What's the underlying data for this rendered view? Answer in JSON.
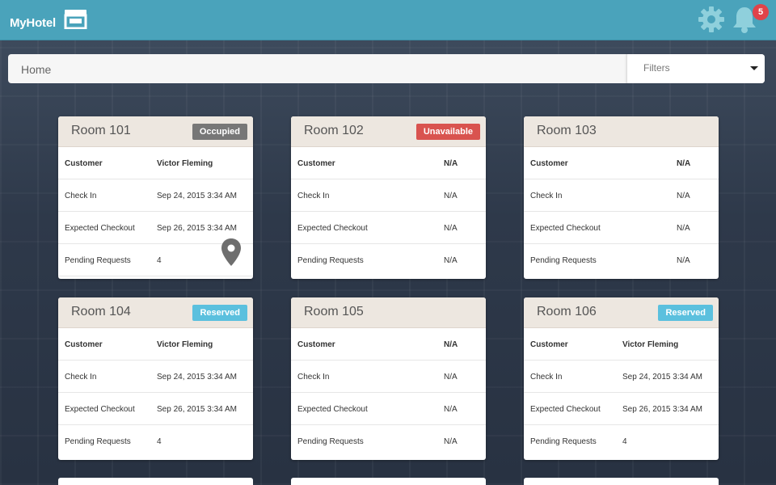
{
  "app": {
    "title": "MyHotel"
  },
  "header": {
    "notification_count": "5"
  },
  "nav": {
    "breadcrumb": "Home",
    "filters_label": "Filters"
  },
  "colors": {
    "topbar": "#4aa3bb",
    "occupied": "#777777",
    "unavailable": "#d9534f",
    "reserved": "#5bc0de"
  },
  "rooms": [
    {
      "name": "Room 101",
      "status": "Occupied",
      "status_color": "#777777",
      "rows": [
        {
          "label": "Customer",
          "value": "Victor Fleming"
        },
        {
          "label": "Check In",
          "value": "Sep 24, 2015 3:34 AM"
        },
        {
          "label": "Expected Checkout",
          "value": "Sep 26, 2015 3:34 AM"
        },
        {
          "label": "Pending Requests",
          "value": "4"
        }
      ]
    },
    {
      "name": "Room 102",
      "status": "Unavailable",
      "status_color": "#d9534f",
      "rows": [
        {
          "label": "Customer",
          "value": "N/A"
        },
        {
          "label": "Check In",
          "value": "N/A"
        },
        {
          "label": "Expected Checkout",
          "value": "N/A"
        },
        {
          "label": "Pending Requests",
          "value": "N/A"
        }
      ]
    },
    {
      "name": "Room 103",
      "status": "",
      "rows": [
        {
          "label": "Customer",
          "value": "N/A"
        },
        {
          "label": "Check In",
          "value": "N/A"
        },
        {
          "label": "Expected Checkout",
          "value": "N/A"
        },
        {
          "label": "Pending Requests",
          "value": "N/A"
        }
      ]
    },
    {
      "name": "Room 104",
      "status": "Reserved",
      "status_color": "#5bc0de",
      "rows": [
        {
          "label": "Customer",
          "value": "Victor Fleming"
        },
        {
          "label": "Check In",
          "value": "Sep 24, 2015 3:34 AM"
        },
        {
          "label": "Expected Checkout",
          "value": "Sep 26, 2015 3:34 AM"
        },
        {
          "label": "Pending Requests",
          "value": "4"
        }
      ]
    },
    {
      "name": "Room 105",
      "status": "",
      "rows": [
        {
          "label": "Customer",
          "value": "N/A"
        },
        {
          "label": "Check In",
          "value": "N/A"
        },
        {
          "label": "Expected Checkout",
          "value": "N/A"
        },
        {
          "label": "Pending Requests",
          "value": "N/A"
        }
      ]
    },
    {
      "name": "Room 106",
      "status": "Reserved",
      "status_color": "#5bc0de",
      "rows": [
        {
          "label": "Customer",
          "value": "Victor Fleming"
        },
        {
          "label": "Check In",
          "value": "Sep 24, 2015 3:34 AM"
        },
        {
          "label": "Expected Checkout",
          "value": "Sep 26, 2015 3:34 AM"
        },
        {
          "label": "Pending Requests",
          "value": "4"
        }
      ]
    }
  ]
}
